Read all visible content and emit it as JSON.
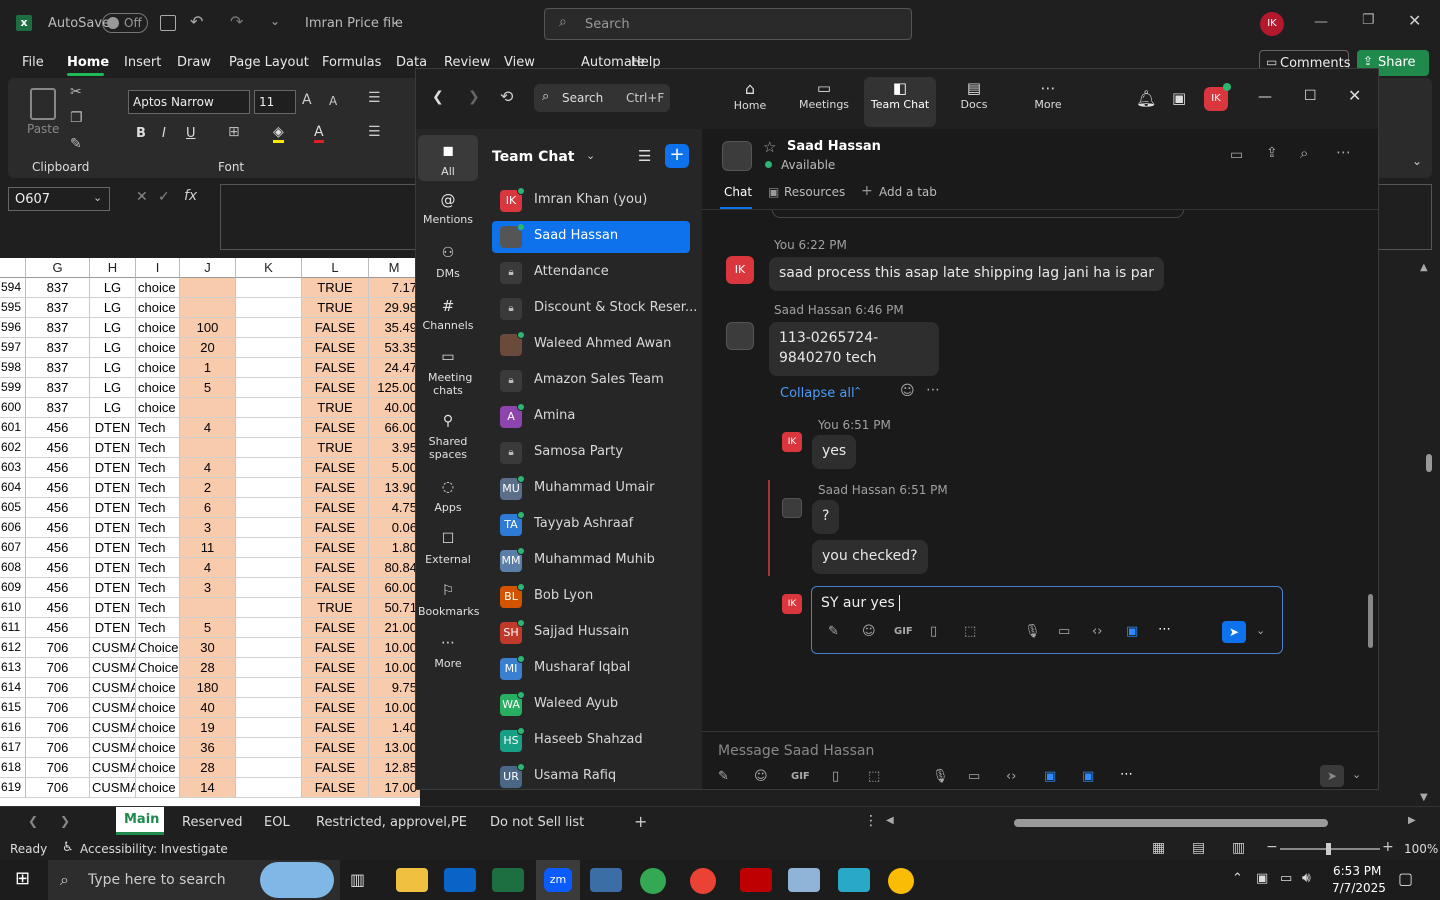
{
  "excel": {
    "autosave": "AutoSave",
    "autosave_state": "Off",
    "file_name": "Imran Price file",
    "search_placeholder": "Search",
    "user_initials": "IK",
    "menu": [
      "File",
      "Home",
      "Insert",
      "Draw",
      "Page Layout",
      "Formulas",
      "Data",
      "Review",
      "View",
      "Automate",
      "Help"
    ],
    "comments": "Comments",
    "share": "Share",
    "font_name": "Aptos Narrow",
    "font_size": "11",
    "paste": "Paste",
    "group_clipboard": "Clipboard",
    "group_font": "Font",
    "name_box": "O607",
    "columns": [
      "G",
      "H",
      "I",
      "J",
      "K",
      "L",
      "M"
    ],
    "rows": [
      {
        "n": "594",
        "g": "837",
        "h": "LG",
        "i": "choice",
        "j": "",
        "l": "TRUE",
        "m": "7.17"
      },
      {
        "n": "595",
        "g": "837",
        "h": "LG",
        "i": "choice",
        "j": "",
        "l": "TRUE",
        "m": "29.98"
      },
      {
        "n": "596",
        "g": "837",
        "h": "LG",
        "i": "choice",
        "j": "100",
        "l": "FALSE",
        "m": "35.49"
      },
      {
        "n": "597",
        "g": "837",
        "h": "LG",
        "i": "choice",
        "j": "20",
        "l": "FALSE",
        "m": "53.35"
      },
      {
        "n": "598",
        "g": "837",
        "h": "LG",
        "i": "choice",
        "j": "1",
        "l": "FALSE",
        "m": "24.47"
      },
      {
        "n": "599",
        "g": "837",
        "h": "LG",
        "i": "choice",
        "j": "5",
        "l": "FALSE",
        "m": "125.00"
      },
      {
        "n": "600",
        "g": "837",
        "h": "LG",
        "i": "choice",
        "j": "",
        "l": "TRUE",
        "m": "40.00"
      },
      {
        "n": "601",
        "g": "456",
        "h": "DTEN",
        "i": "Tech",
        "j": "4",
        "l": "FALSE",
        "m": "66.00"
      },
      {
        "n": "602",
        "g": "456",
        "h": "DTEN",
        "i": "Tech",
        "j": "",
        "l": "TRUE",
        "m": "3.95"
      },
      {
        "n": "603",
        "g": "456",
        "h": "DTEN",
        "i": "Tech",
        "j": "4",
        "l": "FALSE",
        "m": "5.00"
      },
      {
        "n": "604",
        "g": "456",
        "h": "DTEN",
        "i": "Tech",
        "j": "2",
        "l": "FALSE",
        "m": "13.90"
      },
      {
        "n": "605",
        "g": "456",
        "h": "DTEN",
        "i": "Tech",
        "j": "6",
        "l": "FALSE",
        "m": "4.75"
      },
      {
        "n": "606",
        "g": "456",
        "h": "DTEN",
        "i": "Tech",
        "j": "3",
        "l": "FALSE",
        "m": "0.06"
      },
      {
        "n": "607",
        "g": "456",
        "h": "DTEN",
        "i": "Tech",
        "j": "11",
        "l": "FALSE",
        "m": "1.80"
      },
      {
        "n": "608",
        "g": "456",
        "h": "DTEN",
        "i": "Tech",
        "j": "4",
        "l": "FALSE",
        "m": "80.84"
      },
      {
        "n": "609",
        "g": "456",
        "h": "DTEN",
        "i": "Tech",
        "j": "3",
        "l": "FALSE",
        "m": "60.00"
      },
      {
        "n": "610",
        "g": "456",
        "h": "DTEN",
        "i": "Tech",
        "j": "",
        "l": "TRUE",
        "m": "50.71"
      },
      {
        "n": "611",
        "g": "456",
        "h": "DTEN",
        "i": "Tech",
        "j": "5",
        "l": "FALSE",
        "m": "21.00"
      },
      {
        "n": "612",
        "g": "706",
        "h": "CUSMAN",
        "i": "Choice",
        "j": "30",
        "l": "FALSE",
        "m": "10.00"
      },
      {
        "n": "613",
        "g": "706",
        "h": "CUSMAN",
        "i": "Choice",
        "j": "28",
        "l": "FALSE",
        "m": "10.00"
      },
      {
        "n": "614",
        "g": "706",
        "h": "CUSMAN",
        "i": "choice",
        "j": "180",
        "l": "FALSE",
        "m": "9.75"
      },
      {
        "n": "615",
        "g": "706",
        "h": "CUSMAN",
        "i": "choice",
        "j": "40",
        "l": "FALSE",
        "m": "10.00"
      },
      {
        "n": "616",
        "g": "706",
        "h": "CUSMAN",
        "i": "choice",
        "j": "19",
        "l": "FALSE",
        "m": "1.40"
      },
      {
        "n": "617",
        "g": "706",
        "h": "CUSMAN",
        "i": "choice",
        "j": "36",
        "l": "FALSE",
        "m": "13.00"
      },
      {
        "n": "618",
        "g": "706",
        "h": "CUSMAN",
        "i": "choice",
        "j": "28",
        "l": "FALSE",
        "m": "12.85"
      },
      {
        "n": "619",
        "g": "706",
        "h": "CUSMAN",
        "i": "choice",
        "j": "14",
        "l": "FALSE",
        "m": "17.00"
      }
    ],
    "sheet_tabs": [
      "Main",
      "Reserved",
      "EOL",
      "Restricted, approvel,PE",
      "Do not Sell list"
    ],
    "status_ready": "Ready",
    "accessibility": "Accessibility: Investigate",
    "zoom": "100%"
  },
  "zoom": {
    "search_label": "Search",
    "search_shortcut": "Ctrl+F",
    "nav": [
      "Home",
      "Meetings",
      "Team Chat",
      "Docs",
      "More"
    ],
    "user_initials": "IK",
    "rail": [
      "All",
      "Mentions",
      "DMs",
      "Channels",
      "Meeting chats",
      "Shared spaces",
      "Apps",
      "External",
      "Bookmarks",
      "More"
    ],
    "list_title": "Team Chat",
    "contacts": [
      {
        "name": "Imran Khan (you)",
        "initials": "IK",
        "color": "#d9363e",
        "presence": true
      },
      {
        "name": "Saad Hassan",
        "initials": "",
        "color": "#555",
        "presence": true,
        "selected": true
      },
      {
        "name": "Attendance",
        "initials": "",
        "color": "#3a3a3a",
        "lock": true
      },
      {
        "name": "Discount & Stock Reser...",
        "initials": "",
        "color": "#3a3a3a",
        "lock": true
      },
      {
        "name": "Waleed Ahmed Awan",
        "initials": "",
        "color": "#6a4a3a",
        "presence": true
      },
      {
        "name": "Amazon Sales Team",
        "initials": "",
        "color": "#3a3a3a",
        "lock": true
      },
      {
        "name": "Amina",
        "initials": "A",
        "color": "#8e44ad",
        "presence": true
      },
      {
        "name": "Samosa Party",
        "initials": "",
        "color": "#3a3a3a",
        "lock": true
      },
      {
        "name": "Muhammad Umair",
        "initials": "MU",
        "color": "#5b6e8a",
        "presence": true
      },
      {
        "name": "Tayyab Ashraaf",
        "initials": "TA",
        "color": "#2e7bd6",
        "presence": true
      },
      {
        "name": "Muhammad Muhib",
        "initials": "MM",
        "color": "#5b7fa8",
        "presence": true
      },
      {
        "name": "Bob Lyon",
        "initials": "BL",
        "color": "#d35400",
        "presence": true
      },
      {
        "name": "Sajjad Hussain",
        "initials": "SH",
        "color": "#c0392b",
        "presence": true
      },
      {
        "name": "Musharaf Iqbal",
        "initials": "MI",
        "color": "#3a7fd0",
        "presence": true
      },
      {
        "name": "Waleed Ayub",
        "initials": "WA",
        "color": "#27ae60",
        "presence": true
      },
      {
        "name": "Haseeb Shahzad",
        "initials": "HS",
        "color": "#16a085",
        "presence": true
      },
      {
        "name": "Usama Rafiq",
        "initials": "UR",
        "color": "#4a6785",
        "presence": true
      }
    ],
    "chat": {
      "name": "Saad Hassan",
      "status": "Available",
      "tab_chat": "Chat",
      "tab_resources": "Resources",
      "add_tab": "Add a tab",
      "msg1_meta": "You 6:22 PM",
      "msg1": "saad process this asap late shipping lag jani ha is par",
      "msg2_meta": "Saad Hassan 6:46 PM",
      "msg2": "113-0265724-9840270 tech",
      "collapse": "Collapse all",
      "r1_meta": "You 6:51 PM",
      "r1": "yes",
      "r2_meta": "Saad Hassan 6:51 PM",
      "r2a": "?",
      "r2b": "you checked?",
      "reply_draft": "SY aur yes",
      "composer_placeholder": "Message Saad Hassan"
    }
  },
  "taskbar": {
    "search_placeholder": "Type here to search",
    "time": "6:53 PM",
    "date": "7/7/2025"
  }
}
